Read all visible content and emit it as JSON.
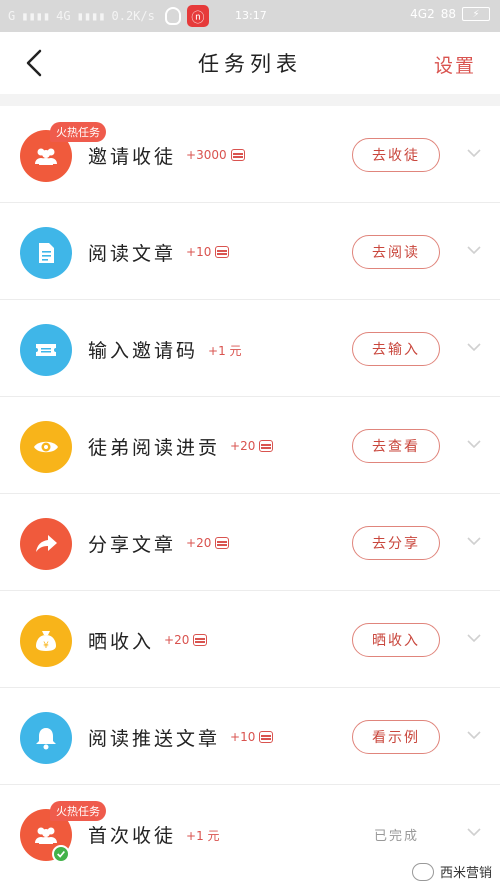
{
  "status_bar": {
    "signal1": "G",
    "signal2": "4G",
    "speed": "0.2K/s",
    "netease": "ⓝ",
    "time": "13:17",
    "right_net": "4G2",
    "battery": "88"
  },
  "nav": {
    "title": "任务列表",
    "settings": "设置"
  },
  "hot_badge": "火热任务",
  "tasks": [
    {
      "name": "邀请收徒",
      "reward": "+3000",
      "has_coin": true,
      "action": "去收徒",
      "icon": "users-icon",
      "color": "#f05a3c",
      "hot": true
    },
    {
      "name": "阅读文章",
      "reward": "+10",
      "has_coin": true,
      "action": "去阅读",
      "icon": "document-icon",
      "color": "#3fb6e8"
    },
    {
      "name": "输入邀请码",
      "reward": "+1 元",
      "has_coin": false,
      "action": "去输入",
      "icon": "ticket-icon",
      "color": "#3fb6e8"
    },
    {
      "name": "徒弟阅读进贡",
      "reward": "+20",
      "has_coin": true,
      "action": "去查看",
      "icon": "eye-icon",
      "color": "#f8b41a"
    },
    {
      "name": "分享文章",
      "reward": "+20",
      "has_coin": true,
      "action": "去分享",
      "icon": "share-icon",
      "color": "#f05a3c"
    },
    {
      "name": "晒收入",
      "reward": "+20",
      "has_coin": true,
      "action": "晒收入",
      "icon": "money-bag-icon",
      "color": "#f8b41a"
    },
    {
      "name": "阅读推送文章",
      "reward": "+10",
      "has_coin": true,
      "action": "看示例",
      "icon": "bell-icon",
      "color": "#3fb6e8"
    },
    {
      "name": "首次收徒",
      "reward": "+1 元",
      "has_coin": false,
      "done_text": "已完成",
      "icon": "users-icon",
      "color": "#f05a3c",
      "hot": true
    }
  ],
  "watermark": "西米营销"
}
